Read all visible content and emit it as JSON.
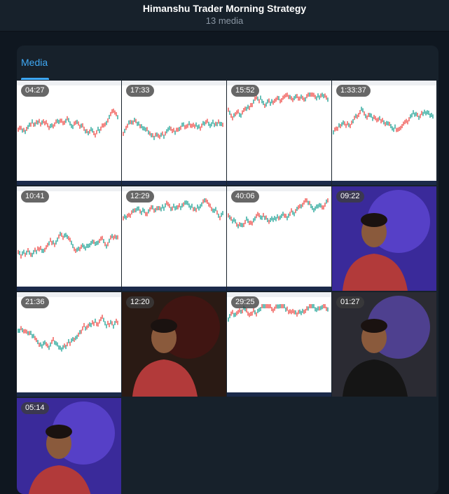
{
  "header": {
    "title": "Himanshu Trader Morning Strategy",
    "subtitle": "13 media"
  },
  "tabs": [
    {
      "label": "Media",
      "active": true
    }
  ],
  "media": [
    {
      "kind": "chart",
      "duration": "04:27"
    },
    {
      "kind": "chart",
      "duration": "17:33"
    },
    {
      "kind": "chart",
      "duration": "15:52"
    },
    {
      "kind": "chart",
      "duration": "1:33:37"
    },
    {
      "kind": "chart",
      "duration": "10:41"
    },
    {
      "kind": "chart",
      "duration": "12:29"
    },
    {
      "kind": "chart",
      "duration": "40:06"
    },
    {
      "kind": "person",
      "duration": "09:22"
    },
    {
      "kind": "chart",
      "duration": "21:36"
    },
    {
      "kind": "person",
      "duration": "12:20"
    },
    {
      "kind": "chart",
      "duration": "29:25"
    },
    {
      "kind": "person",
      "duration": "01:27"
    },
    {
      "kind": "person",
      "duration": "05:14"
    }
  ],
  "colors": {
    "accent": "#3fa9f5",
    "background": "#0f1720",
    "panel": "#17212b"
  }
}
